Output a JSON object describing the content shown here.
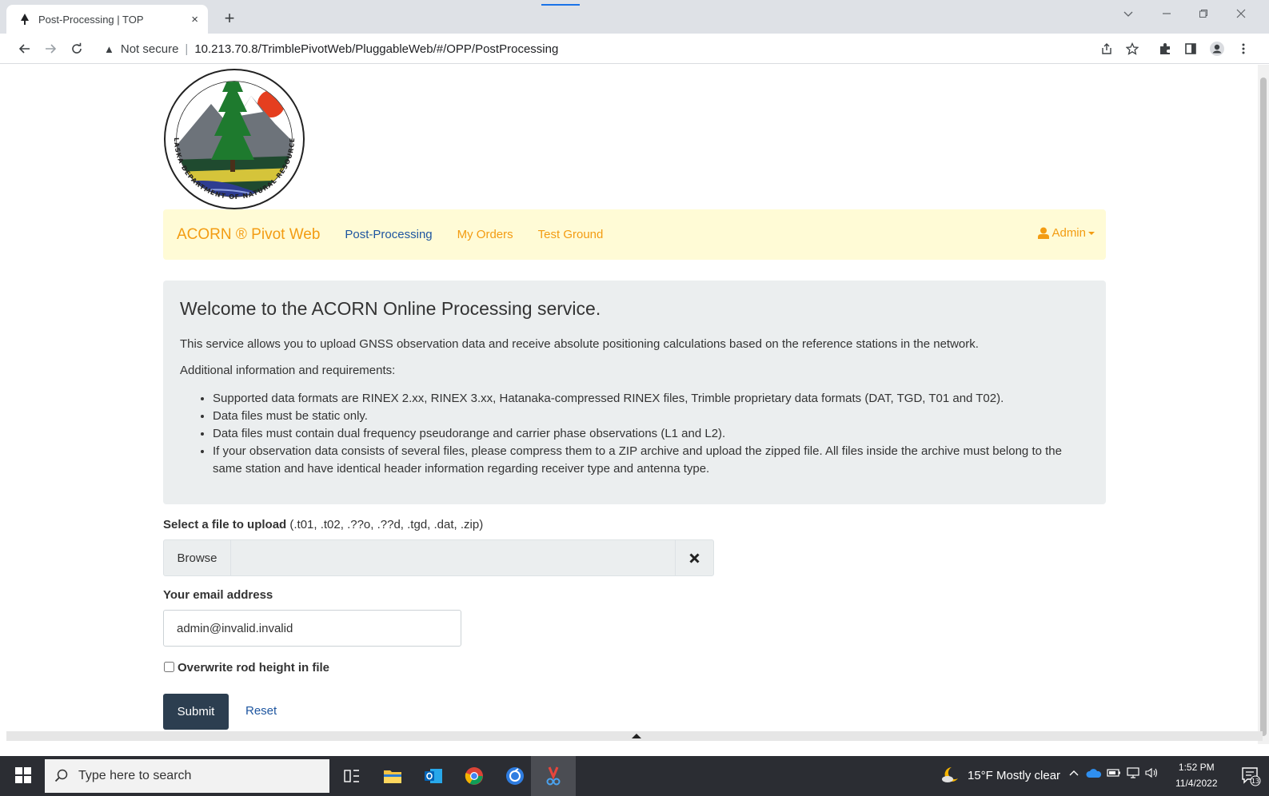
{
  "browser": {
    "tab_title": "Post-Processing | TOP",
    "tab_close": "×",
    "new_tab": "+",
    "security_label": "Not secure",
    "separator": "|",
    "url": "10.213.70.8/TrimblePivotWeb/PluggableWeb/#/OPP/PostProcessing"
  },
  "navbar": {
    "brand": "ACORN ® Pivot Web",
    "links": [
      "Post-Processing",
      "My Orders",
      "Test Ground"
    ],
    "active": "Post-Processing",
    "user": "Admin"
  },
  "logo": {
    "text": "ALASKA DEPARTMENT OF NATURAL RESOURCES"
  },
  "welcome": {
    "heading": "Welcome to the ACORN Online Processing service.",
    "intro": "This service allows you to upload GNSS observation data and receive absolute positioning calculations based on the reference stations in the network.",
    "additional": "Additional information and requirements:",
    "requirements": [
      "Supported data formats are RINEX 2.xx, RINEX 3.xx, Hatanaka-compressed RINEX files, Trimble proprietary data formats (DAT, TGD, T01 and T02).",
      "Data files must be static only.",
      "Data files must contain dual frequency pseudorange and carrier phase observations (L1 and L2).",
      "If your observation data consists of several files, please compress them to a ZIP archive and upload the zipped file. All files inside the archive must belong to the same station and have identical header information regarding receiver type and antenna type."
    ]
  },
  "form": {
    "file_label": "Select a file to upload",
    "file_types": "(.t01, .t02, .??o, .??d, .tgd, .dat, .zip)",
    "browse": "Browse",
    "email_label": "Your email address",
    "email_value": "admin@invalid.invalid",
    "overwrite_label": "Overwrite rod height in file",
    "submit": "Submit",
    "reset": "Reset"
  },
  "taskbar": {
    "search_placeholder": "Type here to search",
    "weather": "15°F  Mostly clear",
    "time": "1:52 PM",
    "date": "11/4/2022",
    "notification_count": "13"
  },
  "colors": {
    "navbar_bg": "#fffbd6",
    "brand": "#f39c12",
    "active_link": "#1e56a0",
    "jumbo_bg": "#ebeeef",
    "submit_bg": "#2c3e50"
  }
}
